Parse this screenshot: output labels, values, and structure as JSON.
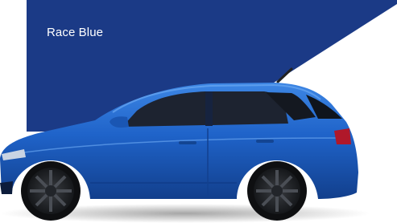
{
  "swatch": {
    "color_name": "Race Blue",
    "panel_color": "#1b3a86",
    "car_color": "#1f63c9"
  }
}
